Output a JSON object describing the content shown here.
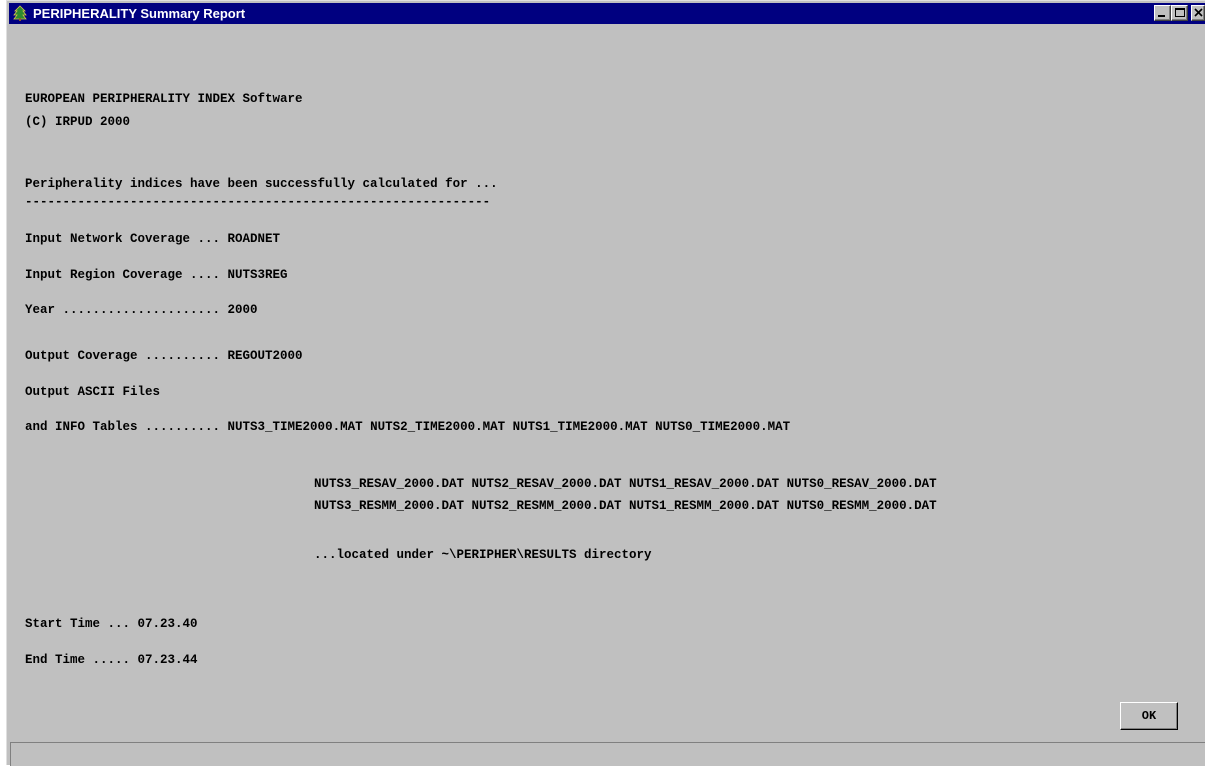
{
  "window": {
    "title": "PERIPHERALITY Summary Report",
    "icon": "app-icon",
    "controls": [
      "minimize-icon",
      "maximize-icon",
      "close-icon"
    ]
  },
  "report": {
    "header_line1": "EUROPEAN PERIPHERALITY INDEX Software",
    "header_line2": "(C) IRPUD 2000",
    "intro": "Peripherality indices have been successfully calculated for ...",
    "separator": "--------------------------------------------------------------",
    "input_network_label": "Input Network Coverage ... ",
    "input_network_value": "ROADNET",
    "input_region_label": "Input Region Coverage .... ",
    "input_region_value": "NUTS3REG",
    "year_label": "Year ..................... ",
    "year_value": "2000",
    "output_coverage_label": "Output Coverage .......... ",
    "output_coverage_value": "REGOUT2000",
    "output_ascii_label": "Output ASCII Files",
    "info_tables_label": "and INFO Tables .......... ",
    "time_files": "NUTS3_TIME2000.MAT NUTS2_TIME2000.MAT NUTS1_TIME2000.MAT NUTS0_TIME2000.MAT",
    "resav_files": "NUTS3_RESAV_2000.DAT NUTS2_RESAV_2000.DAT NUTS1_RESAV_2000.DAT NUTS0_RESAV_2000.DAT",
    "resmm_files": "NUTS3_RESMM_2000.DAT NUTS2_RESMM_2000.DAT NUTS1_RESMM_2000.DAT NUTS0_RESMM_2000.DAT",
    "location_note": "...located under ~\\PERIPHER\\RESULTS directory",
    "start_time_label": "Start Time ... ",
    "start_time_value": "07.23.40",
    "end_time_label": "End Time ..... ",
    "end_time_value": "07.23.44"
  },
  "buttons": {
    "ok_label": "OK"
  },
  "colors": {
    "titlebar": "#000080",
    "window_bg": "#c0c0c0"
  }
}
